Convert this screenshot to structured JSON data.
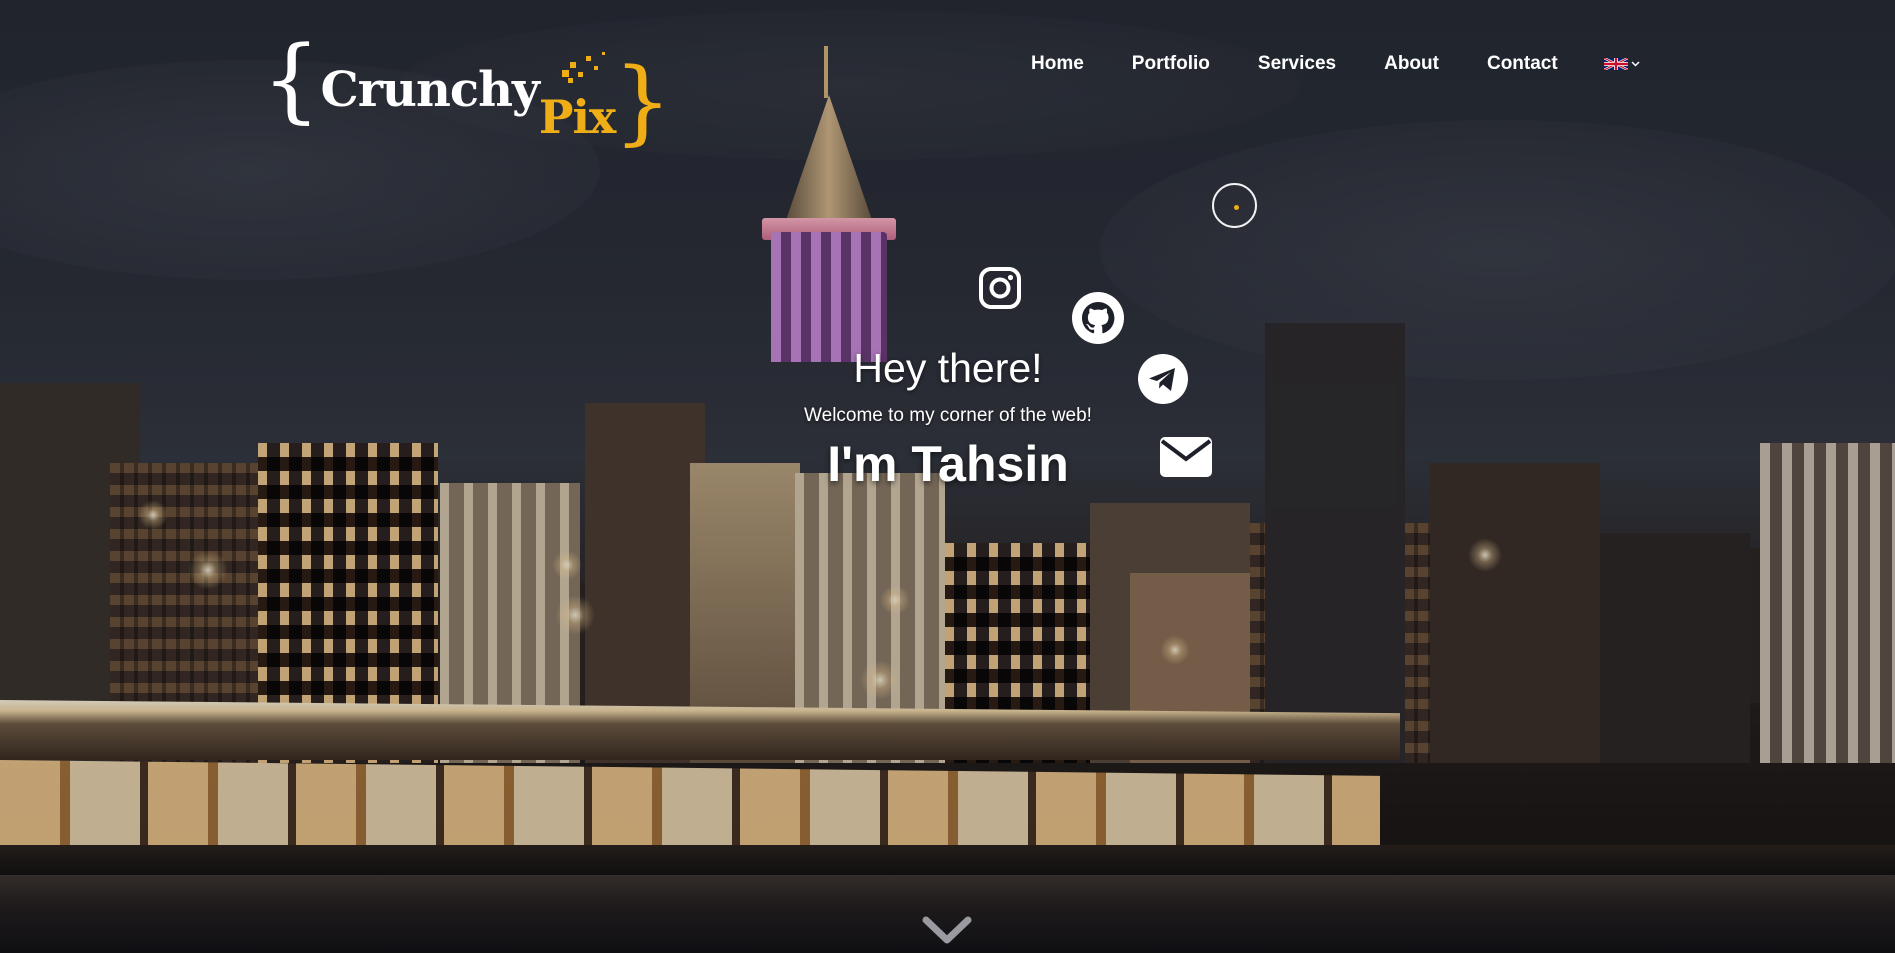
{
  "brand": {
    "logo_open_brace": "{",
    "logo_word_1": "Crunchy",
    "logo_word_2": "Pix",
    "logo_close_brace": "}",
    "accent_color": "#f0ae16"
  },
  "nav": {
    "items": [
      {
        "label": "Home"
      },
      {
        "label": "Portfolio"
      },
      {
        "label": "Services"
      },
      {
        "label": "About"
      },
      {
        "label": "Contact"
      }
    ],
    "language": {
      "icon": "uk-flag-icon",
      "caret": "⌄"
    }
  },
  "social": [
    {
      "name": "Instagram",
      "icon": "instagram-icon"
    },
    {
      "name": "GitHub",
      "icon": "github-icon"
    },
    {
      "name": "Telegram",
      "icon": "telegram-icon"
    },
    {
      "name": "Email",
      "icon": "envelope-icon"
    }
  ],
  "hero": {
    "greeting": "Hey there!",
    "subtitle": "Welcome to my corner of the web!",
    "name": "I'm Tahsin"
  },
  "scroll_indicator": {
    "icon": "chevron-down-icon"
  }
}
